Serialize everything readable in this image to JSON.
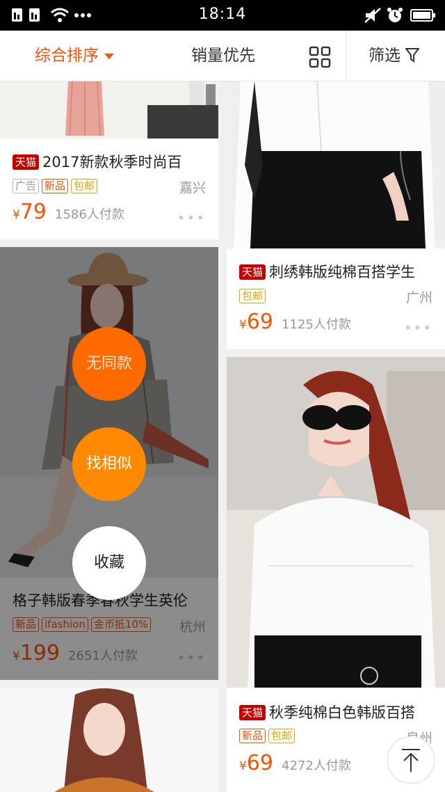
{
  "status_bar": {
    "time": "18:14"
  },
  "toolbar": {
    "sort_label": "综合排序",
    "sales_label": "销量优先",
    "filter_label": "筛选"
  },
  "products": [
    {
      "badge": "天猫",
      "title": "2017新款秋季时尚百",
      "tags": [
        "广告",
        "新品",
        "包邮"
      ],
      "city": "嘉兴",
      "currency": "¥",
      "price": "79",
      "paid": "1586人付款",
      "more": "•••"
    },
    {
      "badge": "天猫",
      "title": "刺绣韩版纯棉百搭学生",
      "tags": [
        "包邮"
      ],
      "city": "广州",
      "currency": "¥",
      "price": "69",
      "paid": "1125人付款",
      "more": "•••"
    },
    {
      "title": "格子韩版春季春秋学生英伦",
      "tags": [
        "新品",
        "ifashion",
        "金币抵10%"
      ],
      "city": "杭州",
      "currency": "¥",
      "price": "199",
      "paid": "2651人付款",
      "more": "•••"
    },
    {
      "badge": "天猫",
      "title": "秋季纯棉白色韩版百搭",
      "tags": [
        "新品",
        "包邮"
      ],
      "city": "泉州",
      "currency": "¥",
      "price": "69",
      "paid": "4272人付款"
    }
  ],
  "actions": {
    "no_same": "无同款",
    "find_similar": "找相似",
    "favorite": "收藏"
  },
  "colors": {
    "accent": "#ff5000",
    "tmall_red": "#c40000"
  }
}
